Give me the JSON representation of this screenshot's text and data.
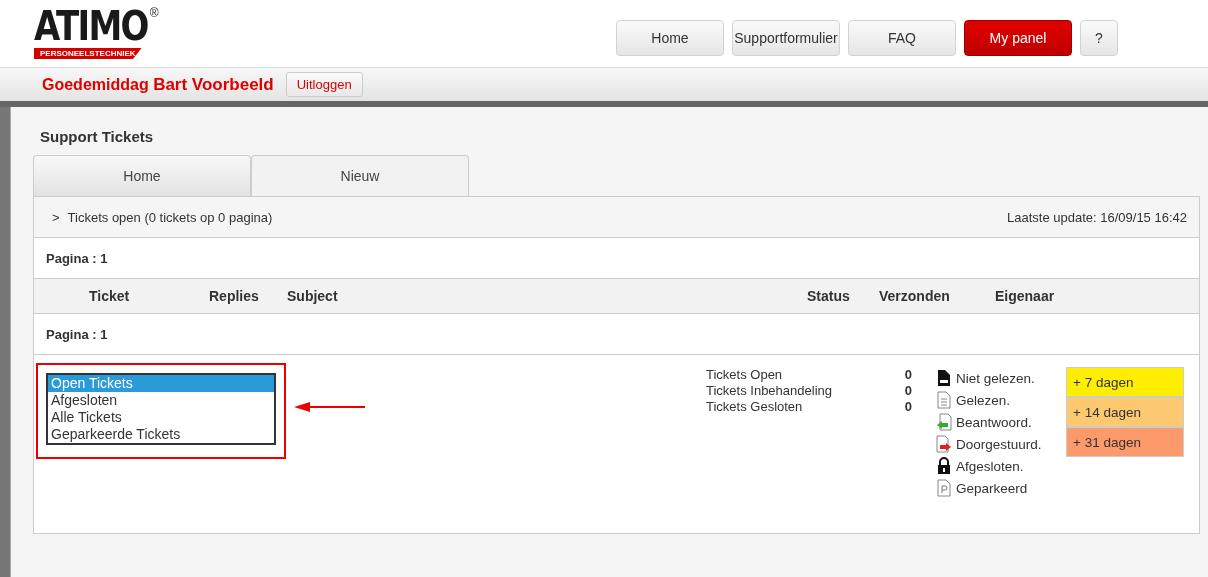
{
  "logo": {
    "name": "ATIMO",
    "registered": "®",
    "tagline": "PERSONEELSTECHNIEK"
  },
  "nav": [
    {
      "label": "Home",
      "selected": false
    },
    {
      "label": "Supportformulier",
      "selected": false
    },
    {
      "label": "FAQ",
      "selected": false
    },
    {
      "label": "My panel",
      "selected": true
    },
    {
      "label": "?",
      "selected": false
    }
  ],
  "greeting": {
    "text": "Goedemiddag **Bart Voorbeeld**",
    "logout": "Uitloggen"
  },
  "panel": {
    "title": "Support Tickets",
    "tabs": [
      {
        "label": "Home",
        "selected": false
      },
      {
        "label": "Nieuw",
        "selected": true
      }
    ],
    "section": {
      "toggle": ">",
      "label": "Tickets open (0 tickets op 0 pagina)",
      "updated": "Laatste update: 16/09/15 16:42"
    },
    "page_top": "Pagina : 1",
    "columns": [
      "Ticket",
      "Replies",
      "Subject",
      "Status",
      "Verzonden",
      "Eigenaar"
    ],
    "page_bottom": "Pagina : 1",
    "filter": [
      {
        "label": "Open Tickets",
        "selected": true
      },
      {
        "label": "Afgesloten",
        "selected": false
      },
      {
        "label": "Alle Tickets",
        "selected": false
      },
      {
        "label": "Geparkeerde Tickets",
        "selected": false
      }
    ],
    "counts": [
      {
        "label": "Tickets Open",
        "value": "0"
      },
      {
        "label": "Tickets Inbehandeling",
        "value": "0"
      },
      {
        "label": "Tickets Gesloten",
        "value": "0"
      }
    ],
    "legend": [
      {
        "kind": "unread",
        "label": "Niet gelezen."
      },
      {
        "kind": "read",
        "label": "Gelezen."
      },
      {
        "kind": "replied",
        "label": "Beantwoord."
      },
      {
        "kind": "forwarded",
        "label": "Doorgestuurd."
      },
      {
        "kind": "closed",
        "label": "Afgesloten."
      },
      {
        "kind": "parked",
        "label": "Geparkeerd"
      }
    ],
    "ages": [
      {
        "label": "+ 7 dagen",
        "color": "#ffee00"
      },
      {
        "label": "+ 14 dagen",
        "color": "#fcc870"
      },
      {
        "label": "+ 31 dagen",
        "color": "#fc9a6c"
      }
    ]
  }
}
